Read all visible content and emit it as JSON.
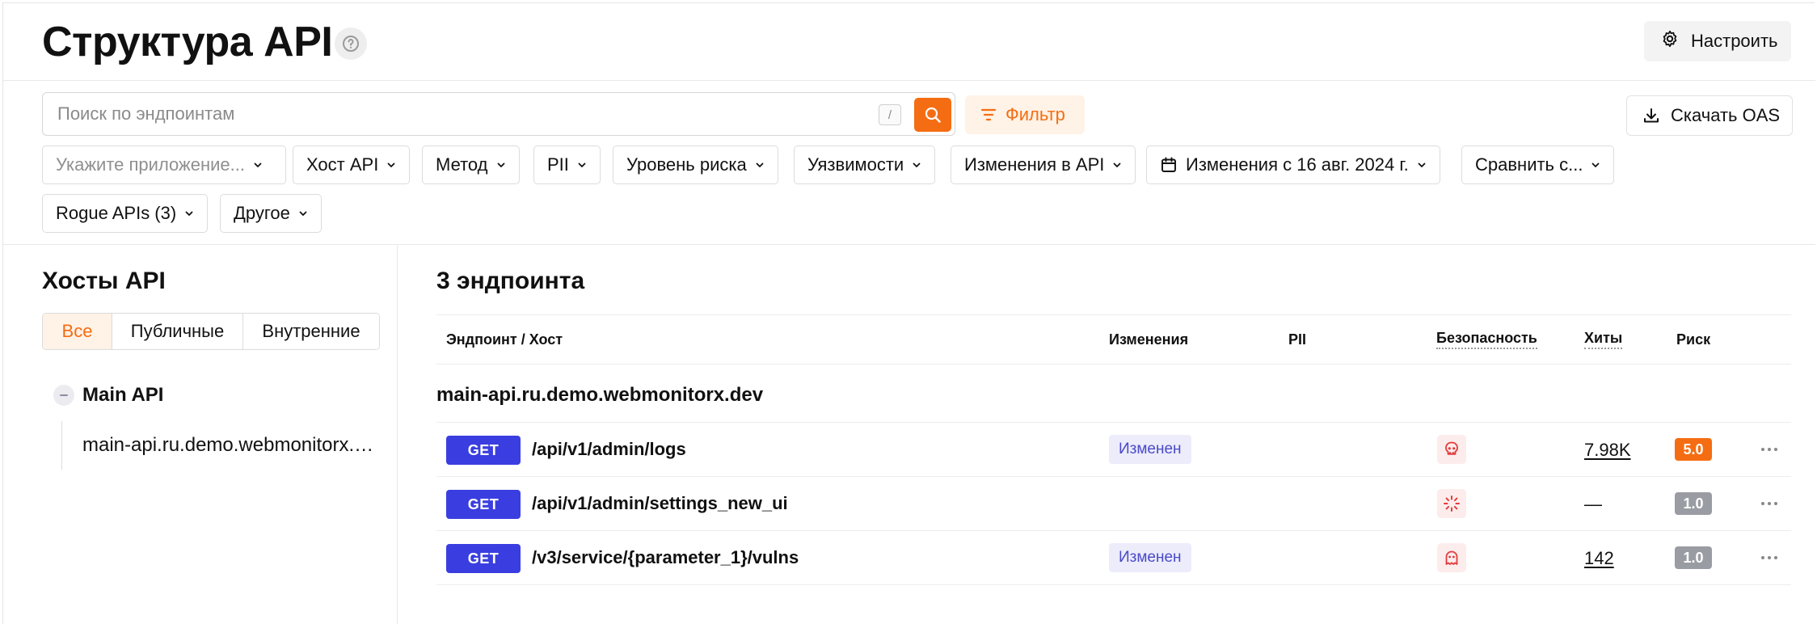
{
  "header": {
    "title": "Структура API",
    "settings_label": "Настроить"
  },
  "toolbar": {
    "search_placeholder": "Поиск по эндпоинтам",
    "search_hotkey": "/",
    "filter_label": "Фильтр",
    "download_label": "Скачать OAS",
    "dropdowns": [
      {
        "label": "Укажите приложение...",
        "placeholder": true
      },
      {
        "label": "Хост API"
      },
      {
        "label": "Метод"
      },
      {
        "label": "PII"
      },
      {
        "label": "Уровень риска"
      },
      {
        "label": "Уязвимости"
      },
      {
        "label": "Изменения в API"
      },
      {
        "label": "Изменения с 16 авг. 2024 г.",
        "icon": "calendar-icon"
      },
      {
        "label": "Сравнить с..."
      },
      {
        "label": "Rogue APIs (3)"
      },
      {
        "label": "Другое"
      }
    ]
  },
  "hosts_panel": {
    "title": "Хосты API",
    "segments": [
      "Все",
      "Публичные",
      "Внутренние"
    ],
    "active_segment": "Все",
    "group_label": "Main API",
    "host_item": "main-api.ru.demo.webmonitorx.dev"
  },
  "endpoints": {
    "title": "3 эндпоинта",
    "columns": {
      "endpoint": "Эндпоинт / Хост",
      "changes": "Изменения",
      "pii": "PII",
      "security": "Безопасность",
      "hits": "Хиты",
      "risk": "Риск"
    },
    "host": "main-api.ru.demo.webmonitorx.dev",
    "rows": [
      {
        "method": "GET",
        "path": "/api/v1/admin/logs",
        "changes": "Изменен",
        "security_icon": "skull-icon",
        "hits": "7.98K",
        "risk": "5.0",
        "risk_color": "#f56d12"
      },
      {
        "method": "GET",
        "path": "/api/v1/admin/settings_new_ui",
        "changes": "",
        "security_icon": "spinner-icon",
        "hits": "—",
        "risk": "1.0",
        "risk_color": "#9a9ca3"
      },
      {
        "method": "GET",
        "path": "/v3/service/{parameter_1}/vulns",
        "changes": "Изменен",
        "security_icon": "ghost-icon",
        "hits": "142",
        "risk": "1.0",
        "risk_color": "#9a9ca3"
      }
    ]
  },
  "colors": {
    "accent": "#f56d12",
    "method_get": "#3a3ee0",
    "risk_high": "#f56d12",
    "risk_low": "#9a9ca3",
    "security_icon": "#e23b3b"
  }
}
